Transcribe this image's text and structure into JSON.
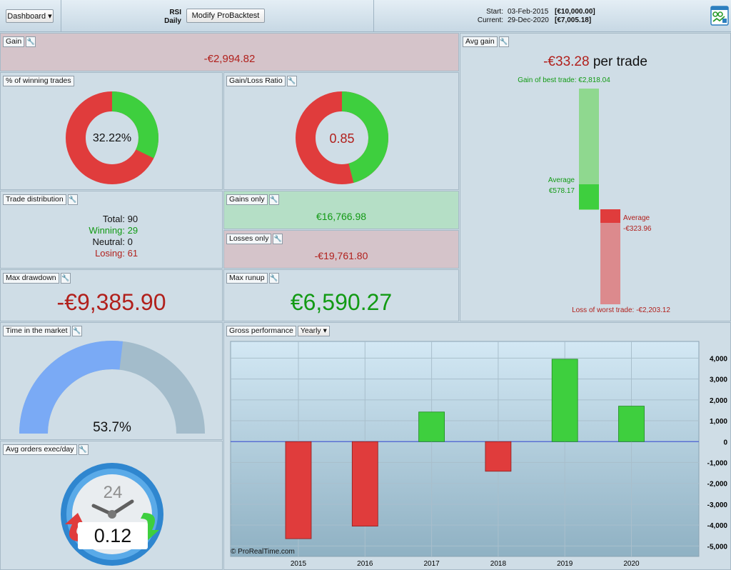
{
  "topbar": {
    "dashboard_label": "Dashboard ▾",
    "strategy_name": "RSI",
    "timeframe": "Daily",
    "modify_button": "Modify ProBacktest",
    "start_label": "Start:",
    "start_date": "03-Feb-2015",
    "start_capital": "[€10,000.00]",
    "current_label": "Current:",
    "current_date": "29-Dec-2020",
    "current_capital": "[€7,005.18]"
  },
  "gain": {
    "title": "Gain",
    "value": "-€2,994.82"
  },
  "winning_trades": {
    "title": "% of winning trades",
    "value": "32.22%",
    "fraction": 0.3222
  },
  "gain_loss_ratio": {
    "title": "Gain/Loss Ratio",
    "value": "0.85",
    "fraction": 0.4595
  },
  "trade_distribution": {
    "title": "Trade distribution",
    "total_label": "Total:",
    "total": "90",
    "winning_label": "Winning:",
    "winning": "29",
    "neutral_label": "Neutral:",
    "neutral": "0",
    "losing_label": "Losing:",
    "losing": "61"
  },
  "gains_only": {
    "title": "Gains only",
    "value": "€16,766.98"
  },
  "losses_only": {
    "title": "Losses only",
    "value": "-€19,761.80"
  },
  "max_drawdown": {
    "title": "Max drawdown",
    "value": "-€9,385.90"
  },
  "max_runup": {
    "title": "Max runup",
    "value": "€6,590.27"
  },
  "avg_gain": {
    "title": "Avg gain",
    "per_trade_value": "-€33.28",
    "per_trade_suffix": " per trade",
    "best_label": "Gain of best trade: €2,818.04",
    "avg_gain_label": "Average",
    "avg_gain_value": "€578.17",
    "avg_loss_label": "Average",
    "avg_loss_value": "-€323.96",
    "worst_label": "Loss of worst trade: -€2,203.12",
    "best": 2818.04,
    "avg_win": 578.17,
    "avg_loss": -323.96,
    "worst": -2203.12
  },
  "time_in_market": {
    "title": "Time in the market",
    "value": "53.7%",
    "fraction": 0.537
  },
  "avg_orders": {
    "title": "Avg orders exec/day",
    "value": "0.12",
    "clock_label": "24"
  },
  "gross_performance": {
    "title": "Gross performance",
    "period": "Yearly ▾",
    "copyright": "© ProRealTime.com"
  },
  "colors": {
    "red": "#e03c3c",
    "green": "#3ecf3e",
    "gauge_fill": "#7aaaf5",
    "gauge_rest": "#a3bccb"
  },
  "chart_data": {
    "type": "bar",
    "categories": [
      "2015",
      "2016",
      "2017",
      "2018",
      "2019",
      "2020"
    ],
    "values": [
      -4650,
      -4050,
      1420,
      -1420,
      3950,
      1700
    ],
    "ylim": [
      -5500,
      4800
    ],
    "yticks": [
      4000,
      3000,
      2000,
      1000,
      0,
      -1000,
      -2000,
      -3000,
      -4000,
      -5000
    ],
    "ytick_labels": [
      "4,000",
      "3,000",
      "2,000",
      "1,000",
      "0",
      "-1,000",
      "-2,000",
      "-3,000",
      "-4,000",
      "-5,000"
    ],
    "grid": true
  }
}
